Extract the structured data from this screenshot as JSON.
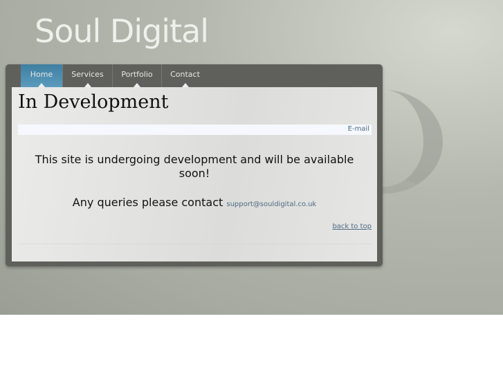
{
  "site": {
    "logo": "Soul Digital"
  },
  "nav": {
    "items": [
      {
        "label": "Home",
        "active": true
      },
      {
        "label": "Services"
      },
      {
        "label": "Portfolio"
      },
      {
        "label": "Contact"
      }
    ]
  },
  "content": {
    "title": "In Development",
    "email_link": "E-mail",
    "message": "This site is undergoing development and will be available soon!",
    "contact_text": "Any queries please contact",
    "contact_email": "support@souldigital.co.uk",
    "back_to_top": "back to top"
  }
}
